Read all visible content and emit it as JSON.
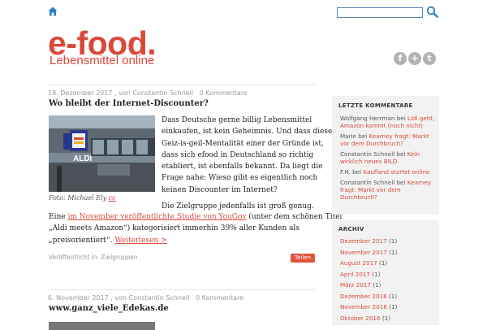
{
  "header": {
    "logo": "e-food.",
    "tagline": "Lebensmittel online",
    "search_placeholder": "",
    "social": [
      "f",
      "+",
      "t"
    ]
  },
  "posts": [
    {
      "date": "18. Dezember 2017",
      "by": ", von",
      "author": "Constantin Schnell",
      "comments": "0 Kommentare",
      "title": "Wo bleibt der Internet-Discounter?",
      "image_caption": "Foto: Michael Ely",
      "image_caption_link": "cc",
      "image_sign": "ALDI",
      "paragraph1": [
        "Dass Deutsche gerne billig Lebensmittel",
        "einkaufen, ist kein Geheimnis. Und dass diese",
        "Geiz-is-geil-Mentalität einer der Gründe ist,",
        "dass sich efood in Deutschland so richtig",
        "etabliert, ist ebenfalls bekannt. Da liegt die",
        "Frage nahe: Wieso gibt es eigentlich noch",
        "keinen Discounter im Internet?"
      ],
      "paragraph2_line1": "Die Zielgruppe jedenfalls ist groß genug.",
      "p2_pre": "Eine ",
      "p2_link": "im November veröffentlichte Studie von YouGov",
      "p2_post": " (unter dem schönen Titel",
      "p2_line3": "„Aldi meets Amazon“) kategorisiert immerhin 39% aller Kunden als",
      "p2_line4_pre": "„preisorientiert“. ",
      "read_more": "Weiterlesen >",
      "published_in": "Veröffentlicht in: Zielgruppen",
      "share": "Teilen"
    },
    {
      "date": "6. November 2017",
      "by": ", von",
      "author": "Constantin Schnell",
      "comments": "0 Kommentare",
      "title": "www.ganz_viele_Edekas.de"
    }
  ],
  "sidebar": {
    "recent_comments_title": "LETZTE KOMMENTARE",
    "comments": [
      {
        "author": "Wolfgang Herrman",
        "bei": " bei ",
        "link": "Lidl geht, Amazon kommt (noch nicht)"
      },
      {
        "author": "Marie",
        "bei": " bei ",
        "link": "Kearney fragt: Markt vor dem Durchbruch?"
      },
      {
        "author": "Constantin Schnell",
        "bei": " bei ",
        "link": "Kein wirklich neues BILD"
      },
      {
        "author": "F.H.",
        "bei": " bei ",
        "link": "Kaufland startet online"
      },
      {
        "author": "Constantin Schnell",
        "bei": " bei ",
        "link": "Kearney fragt: Markt vor dem Durchbruch?"
      }
    ],
    "archive_title": "ARCHIV",
    "archive": [
      {
        "month": "Dezember 2017",
        "count": " (1)"
      },
      {
        "month": "November 2017",
        "count": " (1)"
      },
      {
        "month": "August 2017",
        "count": " (1)"
      },
      {
        "month": "April 2017",
        "count": " (1)"
      },
      {
        "month": "März 2017",
        "count": " (1)"
      },
      {
        "month": "Dezember 2016",
        "count": " (1)"
      },
      {
        "month": "November 2016",
        "count": " (1)"
      },
      {
        "month": "Oktober 2016",
        "count": " (1)"
      }
    ]
  },
  "colors": {
    "accent": "#d9493a",
    "sidebar_bg": "#f2f2f2",
    "search_border": "#5a86b6"
  }
}
